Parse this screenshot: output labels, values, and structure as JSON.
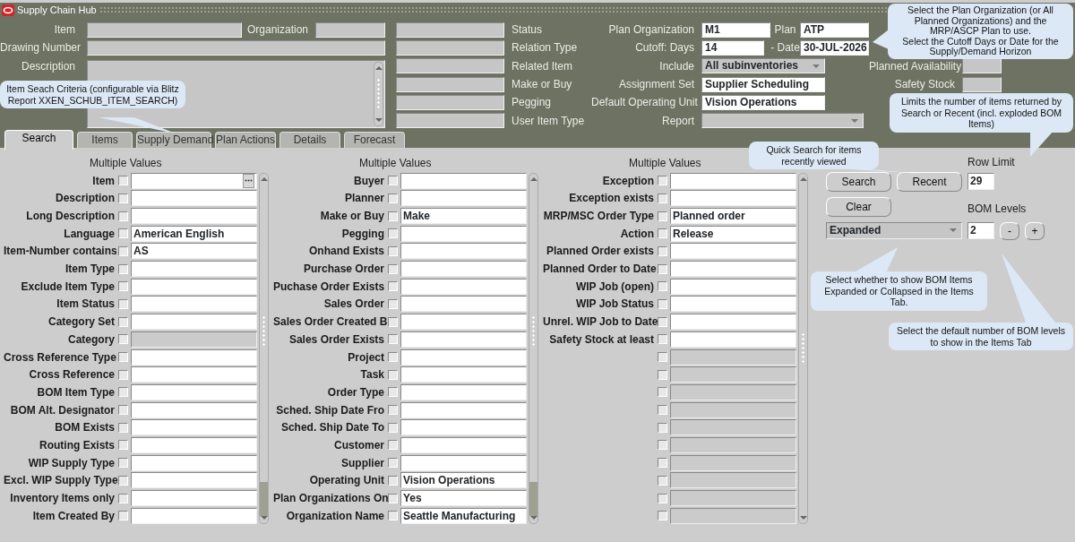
{
  "window": {
    "title": "Supply Chain Hub"
  },
  "header": {
    "item_fields": [
      {
        "label": "Item"
      },
      {
        "label": "Drawing Number"
      },
      {
        "label": "Description",
        "kind": "textarea"
      }
    ],
    "organization": {
      "label": "Organization"
    },
    "status_labels": [
      "Status",
      "Relation Type",
      "Related Item",
      "Make or Buy",
      "Pegging",
      "User Item Type"
    ],
    "plan_fields": [
      {
        "label": "Plan Organization",
        "value": "M1",
        "kind": "text"
      },
      {
        "label": "Cutoff: Days",
        "value": "14",
        "kind": "text"
      },
      {
        "label": "Include",
        "value": "All subinventories",
        "kind": "select"
      },
      {
        "label": "Assignment Set",
        "value": "Supplier Scheduling",
        "kind": "text"
      },
      {
        "label": "Default Operating Unit",
        "value": "Vision Operations",
        "kind": "text"
      },
      {
        "label": "Report",
        "kind": "select"
      }
    ],
    "plan": {
      "label": "Plan",
      "value": "ATP"
    },
    "date": {
      "label": "- Date",
      "value": "30-JUL-2026"
    },
    "side_fields": [
      {
        "label": "Planned Availability"
      },
      {
        "label": "Safety Stock"
      }
    ]
  },
  "tabs": [
    {
      "label": "Search",
      "selected": true
    },
    {
      "label": "Items",
      "selected": false
    },
    {
      "label": "Supply Demand",
      "selected": false
    },
    {
      "label": "Plan Actions",
      "selected": false
    },
    {
      "label": "Details",
      "selected": false
    },
    {
      "label": "Forecast",
      "selected": false
    }
  ],
  "search_columns": [
    {
      "header": "Multiple Values",
      "criteria": [
        {
          "label": "Item",
          "checked": false,
          "kind": "lov"
        },
        {
          "label": "Description",
          "checked": false,
          "kind": "text"
        },
        {
          "label": "Long Description",
          "checked": false,
          "kind": "text"
        },
        {
          "label": "Language",
          "checked": false,
          "kind": "text",
          "value": "American English"
        },
        {
          "label": "Item-Number contains",
          "checked": false,
          "kind": "text",
          "value": "AS"
        },
        {
          "label": "Item Type",
          "checked": false,
          "kind": "text"
        },
        {
          "label": "Exclude Item Type",
          "checked": false,
          "kind": "text"
        },
        {
          "label": "Item Status",
          "checked": false,
          "kind": "text"
        },
        {
          "label": "Category Set",
          "checked": false,
          "kind": "text"
        },
        {
          "label": "Category",
          "checked": false,
          "kind": "disabled"
        },
        {
          "label": "Cross Reference Type",
          "checked": false,
          "kind": "text"
        },
        {
          "label": "Cross Reference",
          "checked": false,
          "kind": "text"
        },
        {
          "label": "BOM Item Type",
          "checked": false,
          "kind": "text"
        },
        {
          "label": "BOM Alt. Designator",
          "checked": false,
          "kind": "text"
        },
        {
          "label": "BOM Exists",
          "checked": false,
          "kind": "text"
        },
        {
          "label": "Routing Exists",
          "checked": false,
          "kind": "text"
        },
        {
          "label": "WIP Supply Type",
          "checked": false,
          "kind": "text"
        },
        {
          "label": "Excl. WIP Supply Type",
          "checked": false,
          "kind": "text"
        },
        {
          "label": "Inventory Items only",
          "checked": false,
          "kind": "text"
        },
        {
          "label": "Item Created By",
          "checked": false,
          "kind": "text"
        }
      ]
    },
    {
      "header": "Multiple Values",
      "criteria": [
        {
          "label": "Buyer",
          "checked": false,
          "kind": "text"
        },
        {
          "label": "Planner",
          "checked": false,
          "kind": "text"
        },
        {
          "label": "Make or Buy",
          "checked": false,
          "kind": "text",
          "value": "Make"
        },
        {
          "label": "Pegging",
          "checked": false,
          "kind": "text"
        },
        {
          "label": "Onhand Exists",
          "checked": false,
          "kind": "text"
        },
        {
          "label": "Purchase Order",
          "checked": false,
          "kind": "text"
        },
        {
          "label": "Puchase Order Exists",
          "checked": false,
          "kind": "text"
        },
        {
          "label": "Sales Order",
          "checked": false,
          "kind": "text"
        },
        {
          "label": "Sales Order Created B",
          "checked": false,
          "kind": "text"
        },
        {
          "label": "Sales Order Exists",
          "checked": false,
          "kind": "text"
        },
        {
          "label": "Project",
          "checked": false,
          "kind": "text"
        },
        {
          "label": "Task",
          "checked": false,
          "kind": "text"
        },
        {
          "label": "Order Type",
          "checked": false,
          "kind": "text"
        },
        {
          "label": "Sched. Ship Date Fro",
          "checked": false,
          "kind": "text"
        },
        {
          "label": "Sched. Ship Date To",
          "checked": false,
          "kind": "text"
        },
        {
          "label": "Customer",
          "checked": false,
          "kind": "text"
        },
        {
          "label": "Supplier",
          "checked": false,
          "kind": "text"
        },
        {
          "label": "Operating Unit",
          "checked": false,
          "kind": "text",
          "value": "Vision Operations"
        },
        {
          "label": "Plan Organizations On",
          "checked": false,
          "kind": "text",
          "value": "Yes"
        },
        {
          "label": "Organization Name",
          "checked": false,
          "kind": "text",
          "value": "Seattle Manufacturing"
        }
      ]
    },
    {
      "header": "Multiple Values",
      "criteria": [
        {
          "label": "Exception",
          "checked": false,
          "kind": "text"
        },
        {
          "label": "Exception exists",
          "checked": false,
          "kind": "text"
        },
        {
          "label": "MRP/MSC Order Type",
          "checked": false,
          "kind": "text",
          "value": "Planned order"
        },
        {
          "label": "Action",
          "checked": false,
          "kind": "text",
          "value": "Release"
        },
        {
          "label": "Planned Order exists",
          "checked": false,
          "kind": "text"
        },
        {
          "label": "Planned Order to Date",
          "checked": false,
          "kind": "text"
        },
        {
          "label": "WIP Job (open)",
          "checked": false,
          "kind": "text"
        },
        {
          "label": "WIP Job Status",
          "checked": false,
          "kind": "text"
        },
        {
          "label": "Unrel. WIP Job to Date",
          "checked": false,
          "kind": "text"
        },
        {
          "label": "Safety Stock at least",
          "checked": false,
          "kind": "text"
        },
        {
          "checked": false,
          "kind": "disabled"
        },
        {
          "checked": false,
          "kind": "disabled"
        },
        {
          "checked": false,
          "kind": "disabled"
        },
        {
          "checked": false,
          "kind": "disabled"
        },
        {
          "checked": false,
          "kind": "disabled"
        },
        {
          "checked": false,
          "kind": "disabled"
        },
        {
          "checked": false,
          "kind": "disabled"
        },
        {
          "checked": false,
          "kind": "disabled"
        },
        {
          "checked": false,
          "kind": "disabled"
        },
        {
          "checked": false,
          "kind": "disabled"
        }
      ]
    }
  ],
  "actions": {
    "buttons": [
      {
        "label": "Search"
      },
      {
        "label": "Recent"
      },
      {
        "label": "Clear"
      }
    ],
    "row_limit": {
      "label": "Row Limit",
      "value": "29"
    },
    "bom_display": {
      "value": "Expanded"
    },
    "bom_levels": {
      "label": "BOM Levels",
      "value": "2",
      "buttons": [
        "-",
        "+"
      ]
    }
  },
  "callouts": [
    {
      "text": "Item Seach Criteria (configurable via Blitz Report XXEN_SCHUB_ITEM_SEARCH)"
    },
    {
      "text": "Select the Plan Organization (or All Planned Organizations) and the MRP/ASCP Plan to use.\nSelect the Cutoff Days or Date for the Supply/Demand Horizon"
    },
    {
      "text": "Limits the number of items returned by Search or Recent (incl. exploded BOM Items)"
    },
    {
      "text": "Quick Search for items recently viewed"
    },
    {
      "text": "Select whether to show BOM Items Expanded or Collapsed in the Items Tab."
    },
    {
      "text": "Select the default number of BOM levels to show in the Items Tab"
    }
  ]
}
